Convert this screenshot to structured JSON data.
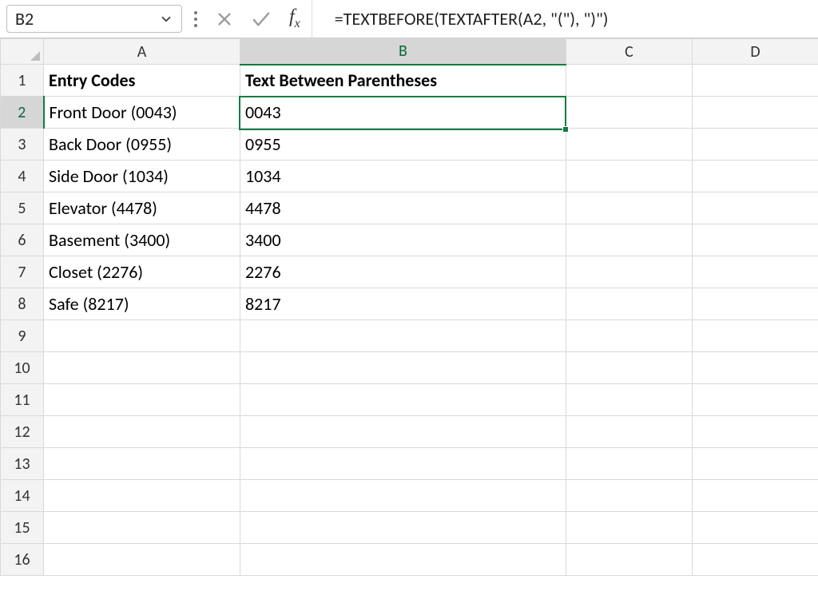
{
  "name_box": {
    "value": "B2"
  },
  "formula_bar": {
    "formula": "=TEXTBEFORE(TEXTAFTER(A2, \"(\"), \")\")"
  },
  "columns": [
    "A",
    "B",
    "C",
    "D"
  ],
  "row_count": 16,
  "active_cell": {
    "col": "B",
    "row": 2
  },
  "header_row": {
    "A": "Entry Codes",
    "B": "Text Between Parentheses"
  },
  "data_rows": [
    {
      "A": "Front Door (0043)",
      "B": "0043"
    },
    {
      "A": "Back Door (0955)",
      "B": "0955"
    },
    {
      "A": "Side Door (1034)",
      "B": "1034"
    },
    {
      "A": "Elevator (4478)",
      "B": "4478"
    },
    {
      "A": "Basement (3400)",
      "B": "3400"
    },
    {
      "A": "Closet (2276)",
      "B": "2276"
    },
    {
      "A": "Safe (8217)",
      "B": "8217"
    }
  ],
  "colors": {
    "selection": "#107c41"
  }
}
